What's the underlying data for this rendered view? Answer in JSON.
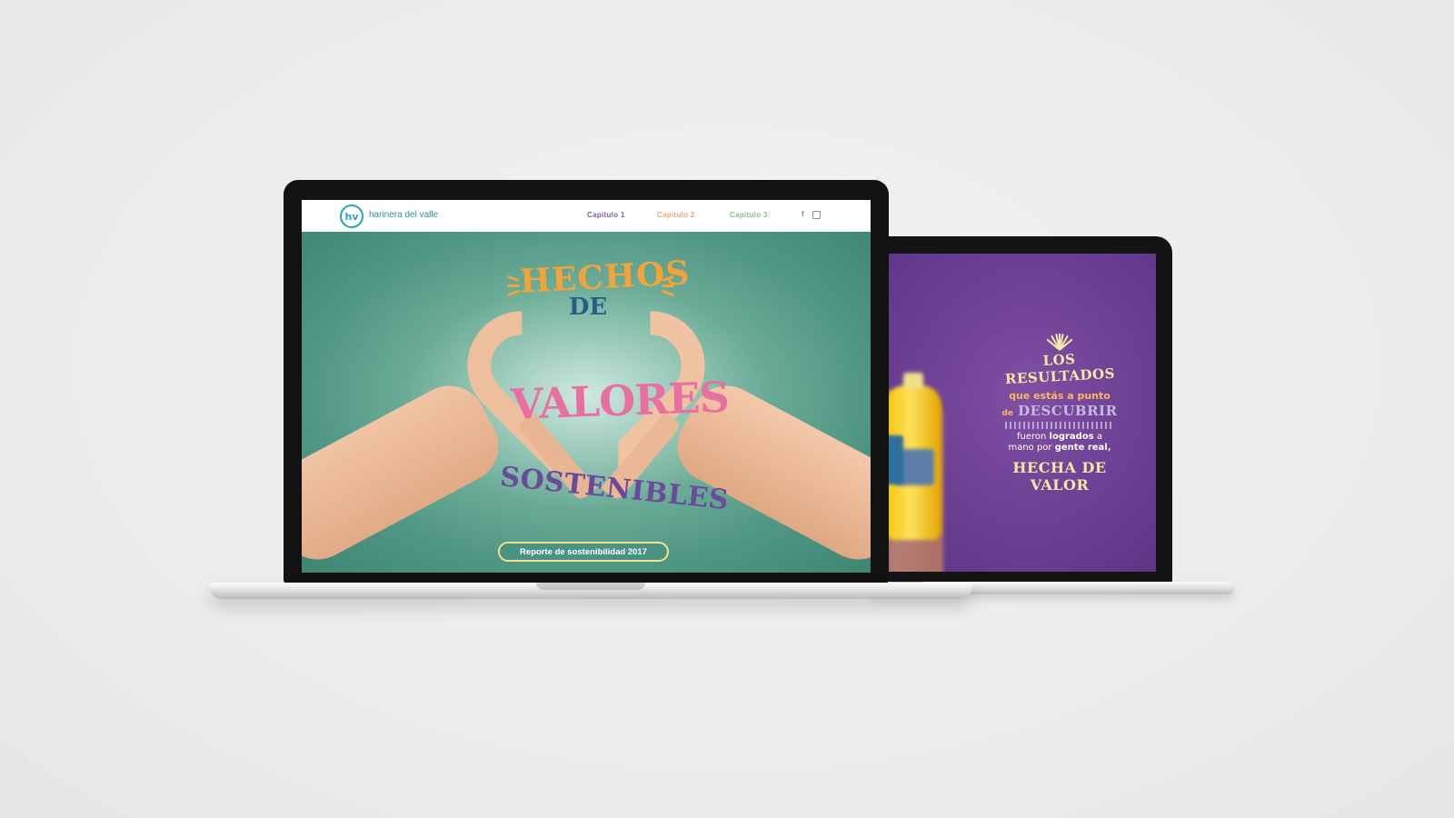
{
  "front_site": {
    "logo_mark": "hv",
    "brand_name": "harinera del valle",
    "nav": {
      "chapter_1": "Capitulo 1",
      "chapter_2": "Capitulo 2",
      "chapter_3": "Capitulo 3"
    },
    "social": {
      "facebook": "f"
    },
    "hero": {
      "line_1": "HECHOS",
      "line_2": "DE",
      "line_3": "VALORES",
      "line_4": "SOSTENIBLES",
      "cta_label": "Reporte de sostenibilidad 2017"
    },
    "colors": {
      "teal_bg": "#4f9684",
      "accent_orange": "#f2a33a",
      "accent_pink": "#e96fa2",
      "accent_purple": "#6a4a9a",
      "cta_border": "#f4e287"
    }
  },
  "back_site": {
    "headline": "LOS RESULTADOS",
    "line_a": "que estás a punto",
    "line_b_small": "de",
    "line_b_big": "DESCUBRIR",
    "body_1": "fueron",
    "body_1_bold": "logrados",
    "body_1_end": "a",
    "body_2": "mano por",
    "body_2_bold": "gente real,",
    "closing": "HECHA DE VALOR",
    "colors": {
      "purple_bg": "#6a3d91",
      "headline_yellow": "#f5e7a6"
    }
  }
}
